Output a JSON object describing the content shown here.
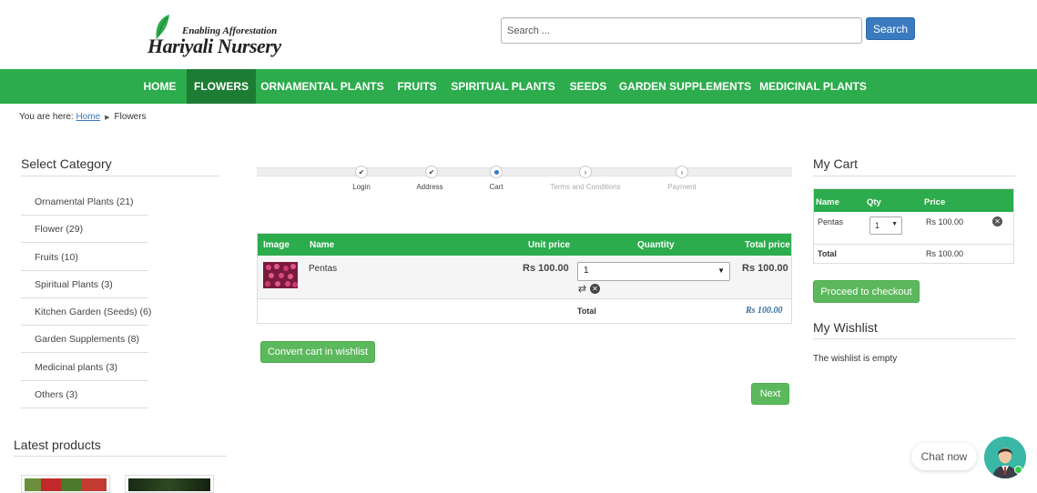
{
  "header": {
    "logo_tagline": "Enabling Afforestation",
    "logo_brand": "Hariyali Nursery",
    "search_placeholder": "Search ...",
    "search_button": "Search"
  },
  "nav": {
    "items": [
      {
        "label": "HOME"
      },
      {
        "label": "FLOWERS"
      },
      {
        "label": "ORNAMENTAL PLANTS"
      },
      {
        "label": "FRUITS"
      },
      {
        "label": "SPIRITUAL PLANTS"
      },
      {
        "label": "SEEDS"
      },
      {
        "label": "GARDEN SUPPLEMENTS"
      },
      {
        "label": "MEDICINAL PLANTS"
      }
    ],
    "active": "FLOWERS",
    "colors": {
      "bar": "#2cac4c",
      "active": "#1d7c34"
    }
  },
  "breadcrumb": {
    "prefix": "You are here:",
    "home": "Home",
    "current": "Flowers"
  },
  "sidebar": {
    "title": "Select Category",
    "categories": [
      {
        "label": "Ornamental Plants (21)"
      },
      {
        "label": "Flower (29)"
      },
      {
        "label": "Fruits (10)"
      },
      {
        "label": "Spiritual Plants (3)"
      },
      {
        "label": "Kitchen Garden (Seeds) (6)"
      },
      {
        "label": "Garden Supplements (8)"
      },
      {
        "label": "Medicinal plants (3)"
      },
      {
        "label": "Others (3)"
      }
    ],
    "latest_title": "Latest products"
  },
  "steps": {
    "items": [
      {
        "label": "Login",
        "state": "done",
        "icon": "check-icon"
      },
      {
        "label": "Address",
        "state": "done",
        "icon": "check-icon"
      },
      {
        "label": "Cart",
        "state": "current",
        "icon": "dot-icon"
      },
      {
        "label": "Terms and Conditions",
        "state": "todo",
        "icon": "chevron-right-icon"
      },
      {
        "label": "Payment",
        "state": "todo",
        "icon": "chevron-right-icon"
      }
    ]
  },
  "cart": {
    "headers": {
      "image": "Image",
      "name": "Name",
      "unit_price": "Unit price",
      "quantity": "Quantity",
      "total_price": "Total price"
    },
    "rows": [
      {
        "name": "Pentas",
        "unit_price": "Rs 100.00",
        "quantity": "1",
        "total_price": "Rs 100.00"
      }
    ],
    "total_label": "Total",
    "total_value": "Rs 100.00",
    "convert_button": "Convert cart in wishlist",
    "next_button": "Next"
  },
  "my_cart": {
    "title": "My Cart",
    "headers": {
      "name": "Name",
      "qty": "Qty",
      "price": "Price"
    },
    "item": {
      "name": "Pentas",
      "qty": "1",
      "price": "Rs 100.00"
    },
    "total_label": "Total",
    "total_value": "Rs 100.00",
    "checkout_button": "Proceed to checkout"
  },
  "wishlist": {
    "title": "My Wishlist",
    "empty_text": "The wishlist is empty"
  },
  "chat": {
    "label": "Chat now"
  }
}
